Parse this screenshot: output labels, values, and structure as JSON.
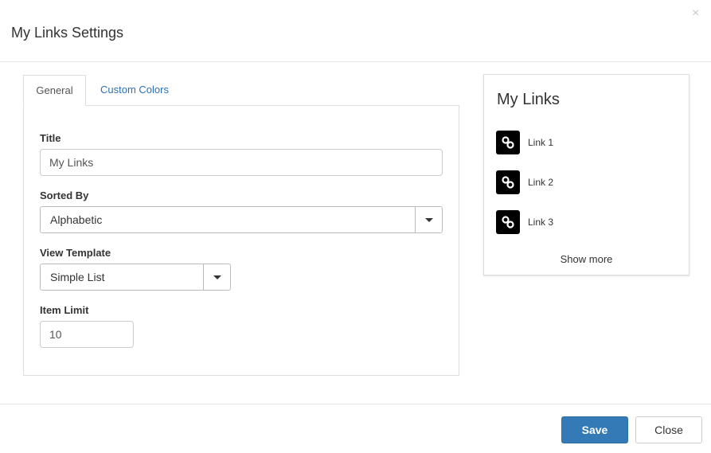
{
  "dialog": {
    "title": "My Links Settings",
    "close_glyph": "×"
  },
  "tabs": [
    {
      "label": "General",
      "active": true
    },
    {
      "label": "Custom Colors",
      "active": false
    }
  ],
  "form": {
    "title_label": "Title",
    "title_value": "My Links",
    "sorted_by_label": "Sorted By",
    "sorted_by_value": "Alphabetic",
    "view_template_label": "View Template",
    "view_template_value": "Simple List",
    "item_limit_label": "Item Limit",
    "item_limit_value": "10"
  },
  "preview": {
    "title": "My Links",
    "links": [
      {
        "label": "Link 1",
        "icon": "link-icon"
      },
      {
        "label": "Link 2",
        "icon": "link-icon"
      },
      {
        "label": "Link 3",
        "icon": "link-icon"
      }
    ],
    "show_more": "Show more"
  },
  "footer": {
    "save_label": "Save",
    "close_label": "Close"
  },
  "colors": {
    "primary": "#337ab7",
    "tab_link": "#2a70b4",
    "icon_bg": "#000000"
  }
}
